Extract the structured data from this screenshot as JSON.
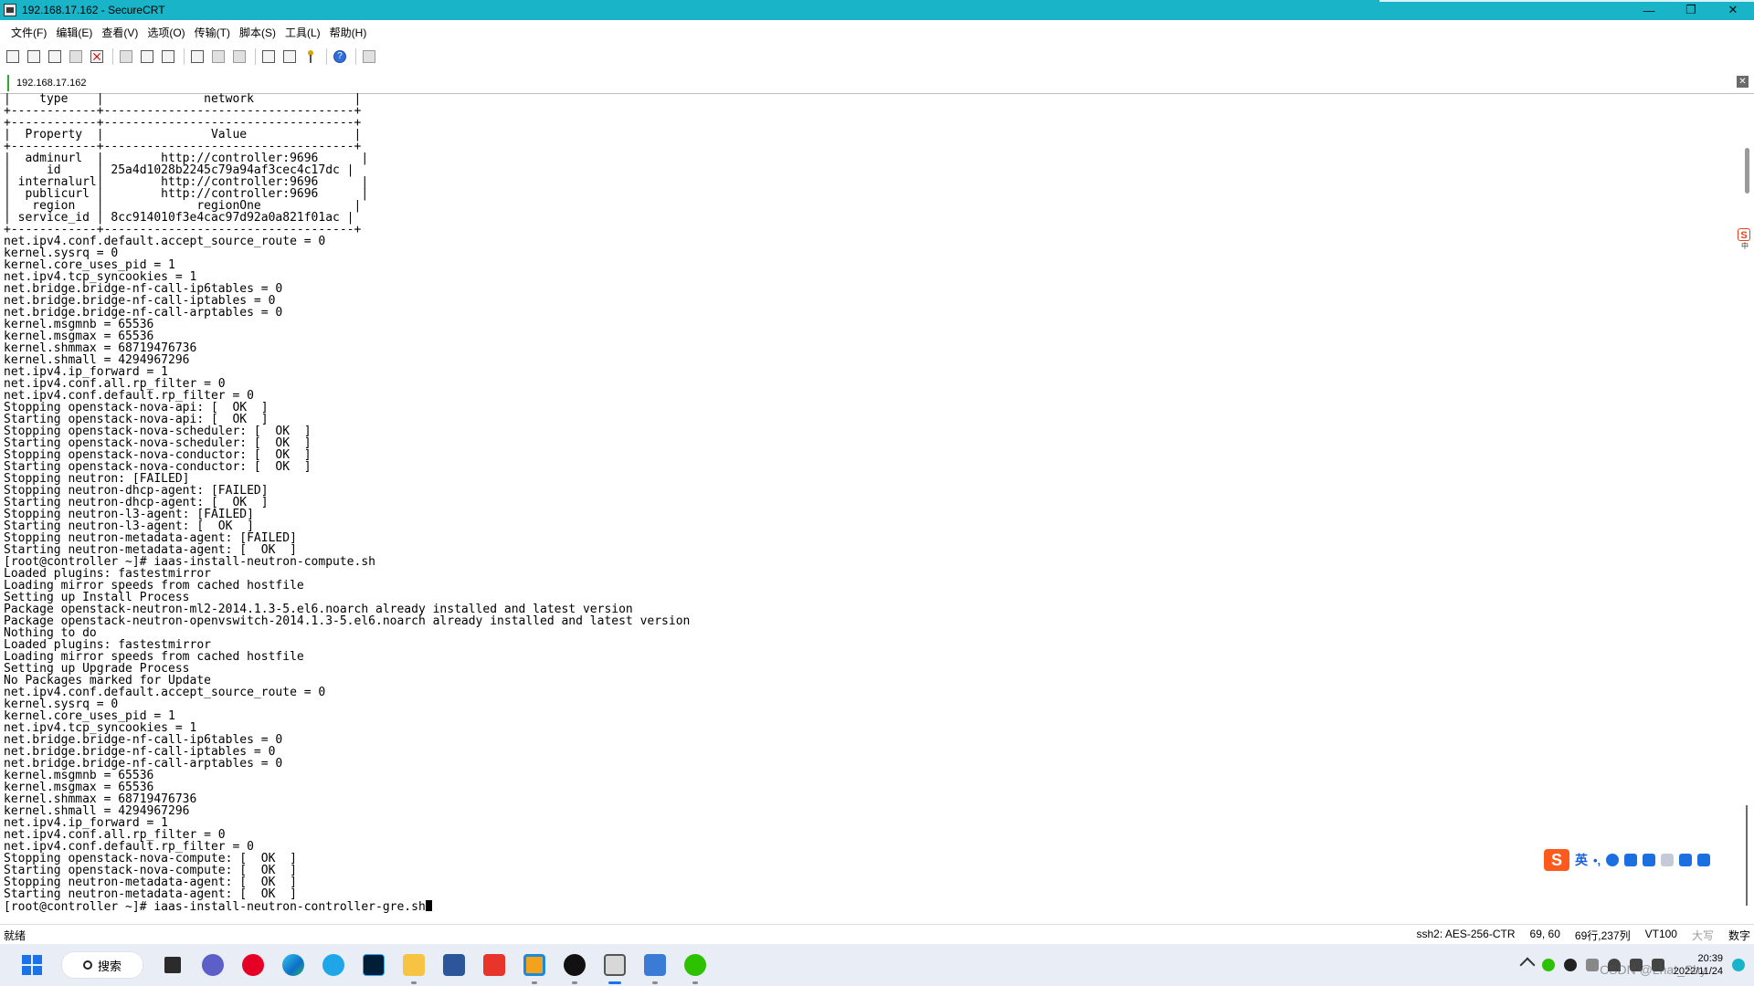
{
  "window": {
    "title": "192.168.17.162 - SecureCRT",
    "minimize": "—",
    "maximize": "❐",
    "close": "✕"
  },
  "menu": [
    "文件(F)",
    "编辑(E)",
    "查看(V)",
    "选项(O)",
    "传输(T)",
    "脚本(S)",
    "工具(L)",
    "帮助(H)"
  ],
  "toolbar_icons": [
    "connect-icon",
    "quick-connect-icon",
    "connect-tab-icon",
    "reconnect-icon",
    "disconnect-icon",
    "copy-icon",
    "paste-icon",
    "find-icon",
    "print-icon",
    "print-selection-icon",
    "printer-icon",
    "session-options-icon",
    "global-options-icon",
    "keymap-icon",
    "help-icon",
    "sftp-icon"
  ],
  "tab": {
    "label": "192.168.17.162",
    "close": "✕"
  },
  "terminal": {
    "lines": [
      "|    type    |              network              |",
      "+------------+-----------------------------------+",
      "+------------+-----------------------------------+",
      "|  Property  |               Value               |",
      "+------------+-----------------------------------+",
      "|  adminurl  |        http://controller:9696      |",
      "|     id     | 25a4d1028b2245c79a94af3cec4c17dc |",
      "| internalurl|        http://controller:9696      |",
      "|  publicurl |        http://controller:9696      |",
      "|   region   |             regionOne             |",
      "| service_id | 8cc914010f3e4cac97d92a0a821f01ac |",
      "+------------+-----------------------------------+",
      "net.ipv4.conf.default.accept_source_route = 0",
      "kernel.sysrq = 0",
      "kernel.core_uses_pid = 1",
      "net.ipv4.tcp_syncookies = 1",
      "net.bridge.bridge-nf-call-ip6tables = 0",
      "net.bridge.bridge-nf-call-iptables = 0",
      "net.bridge.bridge-nf-call-arptables = 0",
      "kernel.msgmnb = 65536",
      "kernel.msgmax = 65536",
      "kernel.shmmax = 68719476736",
      "kernel.shmall = 4294967296",
      "net.ipv4.ip_forward = 1",
      "net.ipv4.conf.all.rp_filter = 0",
      "net.ipv4.conf.default.rp_filter = 0",
      "Stopping openstack-nova-api: [  OK  ]",
      "Starting openstack-nova-api: [  OK  ]",
      "Stopping openstack-nova-scheduler: [  OK  ]",
      "Starting openstack-nova-scheduler: [  OK  ]",
      "Stopping openstack-nova-conductor: [  OK  ]",
      "Starting openstack-nova-conductor: [  OK  ]",
      "Stopping neutron: [FAILED]",
      "Stopping neutron-dhcp-agent: [FAILED]",
      "Starting neutron-dhcp-agent: [  OK  ]",
      "Stopping neutron-l3-agent: [FAILED]",
      "Starting neutron-l3-agent: [  OK  ]",
      "Stopping neutron-metadata-agent: [FAILED]",
      "Starting neutron-metadata-agent: [  OK  ]",
      "[root@controller ~]# iaas-install-neutron-compute.sh",
      "Loaded plugins: fastestmirror",
      "Loading mirror speeds from cached hostfile",
      "Setting up Install Process",
      "Package openstack-neutron-ml2-2014.1.3-5.el6.noarch already installed and latest version",
      "Package openstack-neutron-openvswitch-2014.1.3-5.el6.noarch already installed and latest version",
      "Nothing to do",
      "Loaded plugins: fastestmirror",
      "Loading mirror speeds from cached hostfile",
      "Setting up Upgrade Process",
      "No Packages marked for Update",
      "net.ipv4.conf.default.accept_source_route = 0",
      "kernel.sysrq = 0",
      "kernel.core_uses_pid = 1",
      "net.ipv4.tcp_syncookies = 1",
      "net.bridge.bridge-nf-call-ip6tables = 0",
      "net.bridge.bridge-nf-call-iptables = 0",
      "net.bridge.bridge-nf-call-arptables = 0",
      "kernel.msgmnb = 65536",
      "kernel.msgmax = 65536",
      "kernel.shmmax = 68719476736",
      "kernel.shmall = 4294967296",
      "net.ipv4.ip_forward = 1",
      "net.ipv4.conf.all.rp_filter = 0",
      "net.ipv4.conf.default.rp_filter = 0",
      "Stopping openstack-nova-compute: [  OK  ]",
      "Starting openstack-nova-compute: [  OK  ]",
      "Stopping neutron-metadata-agent: [  OK  ]",
      "Starting neutron-metadata-agent: [  OK  ]"
    ],
    "prompt_line": "[root@controller ~]# iaas-install-neutron-controller-gre.sh"
  },
  "ime": {
    "logo": "S",
    "lang": "英",
    "punct": "•,",
    "side_logo": "S",
    "side_text": "中"
  },
  "status": {
    "ready": "就绪",
    "cipher": "ssh2: AES-256-CTR",
    "cursor": "69,  60",
    "size": "69行,237列",
    "term": "VT100",
    "caps": "大写",
    "num": "数字"
  },
  "taskbar": {
    "search": "搜索",
    "apps": [
      "file-manager-icon",
      "meeting-icon",
      "netease-music-icon",
      "edge-icon",
      "browser-icon",
      "photoshop-icon",
      "folder-icon",
      "word-icon",
      "wps-icon",
      "snipping-icon",
      "media-icon",
      "securecrt-icon",
      "network-icon",
      "wechat-icon"
    ],
    "time": "20:39",
    "date": "2022/11/24",
    "watermark": "CSDN @Lhat_Shy"
  },
  "colors": {
    "titlebar": "#19b4c8",
    "taskbar": "#e9eef6",
    "accent": "#1a73e8"
  }
}
